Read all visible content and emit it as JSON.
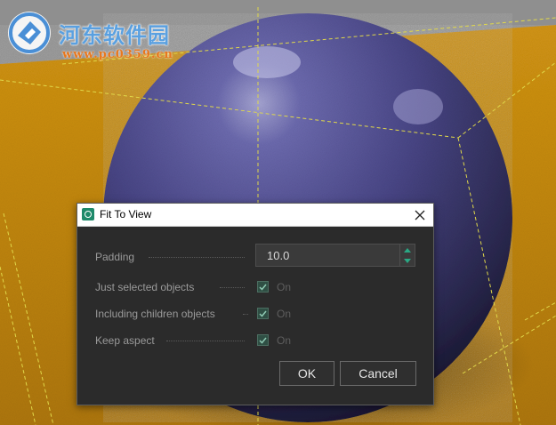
{
  "watermark": {
    "title": "河东软件园",
    "url": "www.pc0359.cn"
  },
  "dialog": {
    "title": "Fit To View",
    "rows": [
      {
        "label": "Padding",
        "value": "10.0"
      },
      {
        "label": "Just selected objects",
        "checked": true,
        "state": "On"
      },
      {
        "label": "Including children objects",
        "checked": true,
        "state": "On"
      },
      {
        "label": "Keep aspect",
        "checked": true,
        "state": "On"
      }
    ],
    "ok_label": "OK",
    "cancel_label": "Cancel"
  },
  "colors": {
    "floor": "#c8890f",
    "sphere": "#4a4788",
    "wireframe": "#e0d84a",
    "dialog_bg": "#2b2b2b",
    "accent": "#1e8a6a"
  },
  "icons": [
    "app-icon",
    "close-icon",
    "chevron-up-icon",
    "chevron-down-icon",
    "checkmark-icon",
    "watermark-logo-icon"
  ]
}
